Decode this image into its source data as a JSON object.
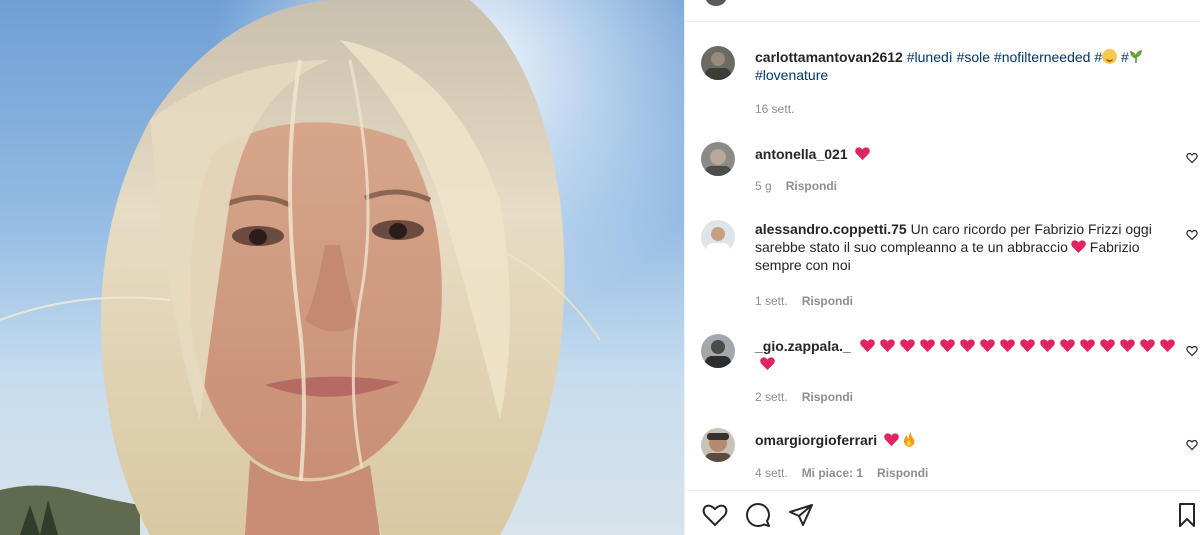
{
  "post": {
    "image": {
      "description_icon": "selfie-photo"
    },
    "caption": {
      "username": "carlottamantovan2612",
      "tags": [
        "#lunedì",
        "#sole",
        "#nofilterneeded",
        "#",
        "#",
        "#lovenature"
      ],
      "time": "16 sett."
    }
  },
  "comments": [
    {
      "username": "antonella_021",
      "text": "",
      "emoji": [
        "heart"
      ],
      "time": "5 g",
      "reply": "Rispondi",
      "likes": ""
    },
    {
      "username": "alessandro.coppetti.75",
      "text_before": "Un caro ricordo per Fabrizio Frizzi oggi sarebbe stato il suo compleanno a te un abbraccio",
      "text_after": "Fabrizio sempre con noi",
      "time": "1 sett.",
      "reply": "Rispondi",
      "likes": ""
    },
    {
      "username": "_gio.zappala._",
      "heart_count": 17,
      "time": "2 sett.",
      "reply": "Rispondi",
      "likes": ""
    },
    {
      "username": "omargiorgioferrari",
      "time": "4 sett.",
      "likes": "Mi piace: 1",
      "reply": "Rispondi"
    }
  ],
  "actions": {
    "like": "heart-outline-icon",
    "comment": "comment-bubble-icon",
    "share": "paper-plane-icon",
    "save": "bookmark-icon"
  },
  "colors": {
    "heart_red": "#ed4956",
    "link_blue": "#00376b",
    "meta_gray": "#8e8e8e"
  }
}
